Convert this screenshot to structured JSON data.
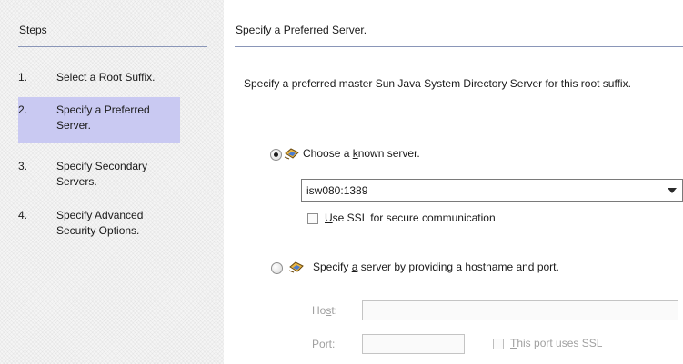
{
  "steps": {
    "title": "Steps",
    "items": [
      {
        "num": "1.",
        "label": "Select a Root Suffix."
      },
      {
        "num": "2.",
        "label": "Specify a Preferred Server.",
        "selected": true
      },
      {
        "num": "3.",
        "label": "Specify Secondary Servers."
      },
      {
        "num": "4.",
        "label": "Specify Advanced Security Options."
      }
    ]
  },
  "main": {
    "title": "Specify a Preferred Server.",
    "description": "Specify a preferred master Sun Java System Directory Server for this root suffix.",
    "known_server": {
      "selected": true,
      "label_pre": "Choose a ",
      "label_mnemonic": "k",
      "label_post": "nown server.",
      "value": "isw080:1389",
      "ssl_checked": false,
      "ssl_label_mnemonic": "U",
      "ssl_label_rest": "se SSL for secure communication"
    },
    "host_port": {
      "selected": false,
      "label_pre": "Specify ",
      "label_mnemonic": "a",
      "label_post": " server by providing a hostname and port.",
      "host_label_pre": "Ho",
      "host_label_mnemonic": "s",
      "host_label_post": "t:",
      "host_value": "",
      "port_label_mnemonic": "P",
      "port_label_post": "ort:",
      "port_value": "",
      "port_ssl_checked": false,
      "port_ssl_mnemonic": "T",
      "port_ssl_rest": "his port uses SSL"
    }
  },
  "icons": {
    "option_icon": "server-wizard-icon",
    "combo_caret": "chevron-down-icon"
  },
  "colors": {
    "selected_step": "#c9c9f2",
    "rule": "#8a96b8",
    "disabled_text": "#a0a0a0"
  }
}
